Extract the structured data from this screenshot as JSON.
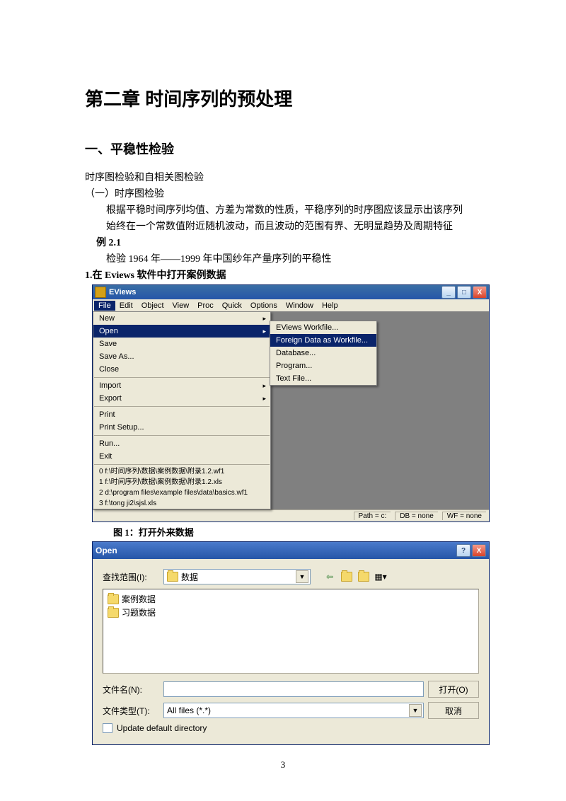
{
  "doc": {
    "chapter_title": "第二章  时间序列的预处理",
    "section_title": "一、平稳性检验",
    "line1": "时序图检验和自相关图检验",
    "line2": "（一）时序图检验",
    "line3": "根据平稳时间序列均值、方差为常数的性质，平稳序列的时序图应该显示出该序列",
    "line4": "始终在一个常数值附近随机波动，而且波动的范围有界、无明显趋势及周期特征",
    "line5": "例 2.1",
    "line6": "检验 1964 年——1999 年中国纱年产量序列的平稳性",
    "line7": "1.在 Eviews 软件中打开案例数据",
    "fig1_caption": "图 1：打开外来数据",
    "page_number": "3"
  },
  "eviews": {
    "title": "EViews",
    "btn_min": "_",
    "btn_max": "□",
    "btn_close": "X",
    "menubar": {
      "file": "File",
      "edit": "Edit",
      "object": "Object",
      "view": "View",
      "proc": "Proc",
      "quick": "Quick",
      "options": "Options",
      "window": "Window",
      "help": "Help"
    },
    "file_menu": {
      "new": "New",
      "open": "Open",
      "save": "Save",
      "save_as": "Save As...",
      "close": "Close",
      "import": "Import",
      "export": "Export",
      "print": "Print",
      "print_setup": "Print Setup...",
      "run": "Run...",
      "exit": "Exit",
      "recent0": "0 f:\\时间序列\\数据\\案例数据\\附录1.2.wf1",
      "recent1": "1 f:\\时间序列\\数据\\案例数据\\附录1.2.xls",
      "recent2": "2 d:\\program files\\example files\\data\\basics.wf1",
      "recent3": "3 f:\\tong ji2\\sjsl.xls"
    },
    "submenu": {
      "eviews_workfile": "EViews Workfile...",
      "foreign_data": "Foreign Data as Workfile...",
      "database": "Database...",
      "program": "Program...",
      "text_file": "Text File..."
    },
    "status": {
      "path": "Path = c:",
      "db": "DB = none",
      "wf": "WF = none"
    }
  },
  "open_dlg": {
    "title": "Open",
    "btn_help": "?",
    "btn_close": "X",
    "look_in_label": "查找范围(I):",
    "look_in_value": "数据",
    "files": {
      "f0": "案例数据",
      "f1": "习题数据"
    },
    "filename_label": "文件名(N):",
    "filename_value": "",
    "filetype_label": "文件类型(T):",
    "filetype_value": "All files (*.*)",
    "open_btn": "打开(O)",
    "cancel_btn": "取消",
    "update_default": "Update default directory"
  }
}
